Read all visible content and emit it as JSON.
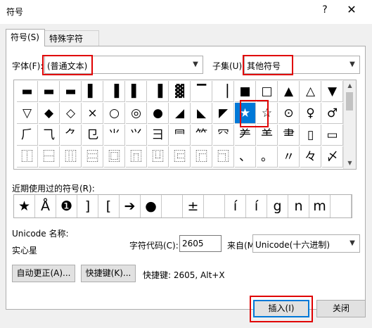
{
  "window": {
    "title": "符号",
    "help_glyph": "?",
    "close_glyph": "✕"
  },
  "tabs": [
    {
      "label": "符号(S)",
      "active": true
    },
    {
      "label": "特殊字符(P)",
      "active": false
    }
  ],
  "font": {
    "label": "字体(F):",
    "value": "(普通文本)"
  },
  "subset": {
    "label": "子集(U):",
    "value": "其他符号"
  },
  "symbol_grid": {
    "rows": [
      [
        "▬",
        "▬",
        "▬",
        "▌",
        "▐",
        "▌",
        "▐",
        "▓",
        "▔",
        "▕",
        "■",
        "□",
        "▲",
        "△",
        "▼"
      ],
      [
        "▽",
        "◆",
        "◇",
        "×",
        "○",
        "◎",
        "●",
        "◢",
        "◣",
        "◤",
        "★",
        "☆",
        "⊙",
        "♀",
        "♂"
      ],
      [
        "⺁",
        "⺄",
        "⺈",
        "⺋",
        "⺌",
        "⺍",
        "⺕",
        "⺜",
        "⺮",
        "⺳",
        "⺶",
        "⺷",
        "⺻",
        "▯",
        "▭"
      ],
      [
        "⿰",
        "⿱",
        "⿲",
        "⿳",
        "⿴",
        "⿵",
        "⿶",
        "⿷",
        "⿸",
        "⿹",
        "、",
        "。",
        "〃",
        "々",
        "〆"
      ]
    ],
    "selected": "★"
  },
  "recent": {
    "label": "近期使用过的符号(R):",
    "symbols": [
      "★",
      "Å",
      "❶",
      "]",
      "[",
      "➔",
      "●",
      "",
      "±",
      "",
      "í",
      "í",
      "g",
      "n",
      "m",
      ""
    ]
  },
  "unicode": {
    "name_label": "Unicode 名称:",
    "name_value": "实心星",
    "code_label": "字符代码(C):",
    "code_value": "2605",
    "from_label": "来自(M):",
    "from_value": "Unicode(十六进制)"
  },
  "buttons": {
    "autocorrect": "自动更正(A)...",
    "shortcut": "快捷键(K)...",
    "shortcut_text": "快捷键: 2605, Alt+X",
    "insert": "插入(I)",
    "close": "关闭"
  },
  "colors": {
    "highlight": "#e00000",
    "selection": "#0078d7"
  }
}
